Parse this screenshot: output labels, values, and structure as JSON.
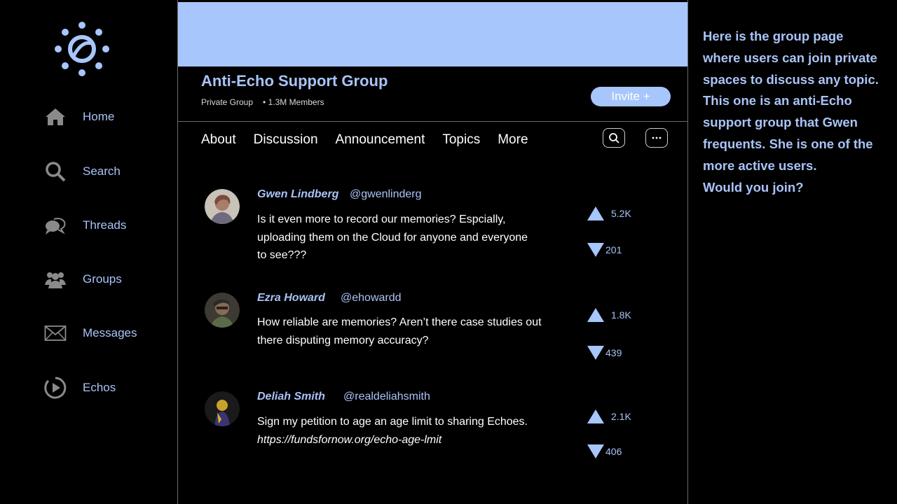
{
  "sidebar": {
    "logo": "sun-logo",
    "items": [
      {
        "label": "Home",
        "icon": "home-icon"
      },
      {
        "label": "Search",
        "icon": "search-icon"
      },
      {
        "label": "Threads",
        "icon": "chat-bubbles-icon"
      },
      {
        "label": "Groups",
        "icon": "people-icon"
      },
      {
        "label": "Messages",
        "icon": "envelope-icon"
      },
      {
        "label": "Echos",
        "icon": "play-circle-icon"
      }
    ]
  },
  "group": {
    "title": "Anti-Echo Support Group",
    "privacy": "Private Group",
    "members": "• 1.3M Members",
    "invite_label": "Invite +"
  },
  "tabs": [
    "About",
    "Discussion",
    "Announcement",
    "Topics",
    "More"
  ],
  "posts": [
    {
      "name": "Gwen Lindberg",
      "handle": "@gwenlinderg",
      "lines": [
        "Is it even more to record our memories? Espcially,",
        "uploading them on the Cloud for anyone and everyone",
        "to see???"
      ],
      "link": "",
      "up": "5.2K",
      "down": "201"
    },
    {
      "name": "Ezra Howard",
      "handle": "@ehowardd",
      "lines": [
        "How reliable are memories? Aren’t there case studies out",
        "there disputing memory accuracy?"
      ],
      "link": "",
      "up": "1.8K",
      "down": "439"
    },
    {
      "name": "Deliah Smith",
      "handle": "@realdeliahsmith",
      "lines": [
        "Sign my petition to age an age limit to sharing Echoes."
      ],
      "link": "https://fundsfornow.org/echo-age-lmit",
      "up": "2.1K",
      "down": "406"
    }
  ],
  "note": {
    "lines": [
      "Here is the group page",
      "where users can join private",
      "spaces to discuss any topic.",
      "This one is an anti-Echo",
      "support group that Gwen",
      "frequents. She is one of the",
      "more active users.",
      "Would you join?"
    ]
  },
  "colors": {
    "accent": "#a9c3f7",
    "banner": "#a7c6fb",
    "background": "#000000"
  }
}
